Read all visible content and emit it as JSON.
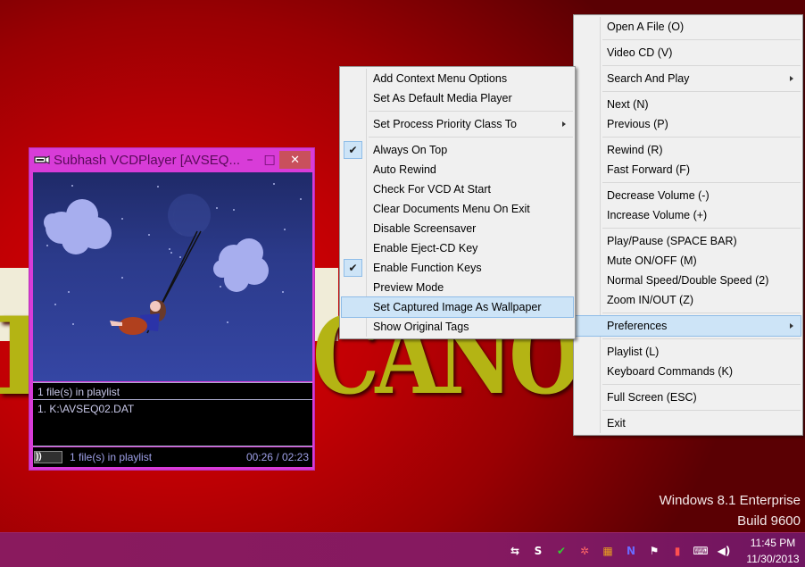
{
  "desktop": {
    "watermark_line1": "Windows 8.1 Enterprise",
    "watermark_line2": "Build 9600",
    "wallpaper_letters_left": "K",
    "wallpaper_letters_right": "CANO"
  },
  "player": {
    "title": "Subhash VCDPlayer [AVSEQ...",
    "icon": "vcd-app-icon",
    "minimize_label": "–",
    "maximize_label": "□",
    "close_label": "✕",
    "playlist_header": "1 file(s) in playlist",
    "playlist_items": [
      "1. K:\\AVSEQ02.DAT"
    ],
    "status_text": "1 file(s) in playlist",
    "time": "00:26 / 02:23",
    "seek_knob": "))",
    "seek_progress": 0.18
  },
  "main_menu": {
    "items": [
      {
        "label": "Open A File (O)"
      },
      {
        "sep": true
      },
      {
        "label": "Video CD (V)"
      },
      {
        "sep": true
      },
      {
        "label": "Search And Play",
        "submenu": true
      },
      {
        "sep": true
      },
      {
        "label": "Next (N)"
      },
      {
        "label": "Previous (P)"
      },
      {
        "sep": true
      },
      {
        "label": "Rewind (R)"
      },
      {
        "label": "Fast Forward (F)"
      },
      {
        "sep": true
      },
      {
        "label": "Decrease Volume (-)"
      },
      {
        "label": "Increase Volume (+)"
      },
      {
        "sep": true
      },
      {
        "label": "Play/Pause (SPACE BAR)"
      },
      {
        "label": "Mute ON/OFF (M)"
      },
      {
        "label": "Normal Speed/Double Speed (2)"
      },
      {
        "label": "Zoom IN/OUT (Z)"
      },
      {
        "sep": true
      },
      {
        "label": "Preferences",
        "submenu": true,
        "highlighted": true
      },
      {
        "sep": true
      },
      {
        "label": "Playlist (L)"
      },
      {
        "label": "Keyboard Commands (K)"
      },
      {
        "sep": true
      },
      {
        "label": "Full Screen  (ESC)"
      },
      {
        "sep": true
      },
      {
        "label": "Exit"
      }
    ]
  },
  "preferences_menu": {
    "items": [
      {
        "label": "Add Context Menu Options"
      },
      {
        "label": "Set As Default Media Player"
      },
      {
        "sep": true
      },
      {
        "label": "Set Process Priority Class To",
        "submenu": true
      },
      {
        "sep": true
      },
      {
        "label": "Always On Top",
        "checked": true
      },
      {
        "label": "Auto Rewind"
      },
      {
        "label": "Check For VCD At Start"
      },
      {
        "label": "Clear Documents Menu On Exit"
      },
      {
        "label": "Disable Screensaver"
      },
      {
        "label": "Enable Eject-CD Key"
      },
      {
        "label": "Enable Function Keys",
        "checked": true
      },
      {
        "label": "Preview Mode"
      },
      {
        "label": "Set Captured Image As Wallpaper",
        "highlighted": true
      },
      {
        "label": "Show Original Tags"
      }
    ]
  },
  "taskbar": {
    "tray_icons": [
      {
        "name": "vcdplayer-tray-icon",
        "glyph": "⇆",
        "color": "#ffffff"
      },
      {
        "name": "skype-tray-icon",
        "glyph": "S",
        "color": "#ffffff"
      },
      {
        "name": "usb-safe-remove-icon",
        "glyph": "✔",
        "color": "#33cc33"
      },
      {
        "name": "network-share-icon",
        "glyph": "✲",
        "color": "#ff6666"
      },
      {
        "name": "winrar-icon",
        "glyph": "▦",
        "color": "#e8a020"
      },
      {
        "name": "norton-icon",
        "glyph": "N",
        "color": "#6a6aff"
      },
      {
        "name": "action-center-flag-icon",
        "glyph": "⚑",
        "color": "#ffffff"
      },
      {
        "name": "power-battery-icon",
        "glyph": "▮",
        "color": "#ff5050"
      },
      {
        "name": "network-icon",
        "glyph": "⌨",
        "color": "#ffffff"
      },
      {
        "name": "volume-icon",
        "glyph": "◀)",
        "color": "#ffffff"
      }
    ],
    "clock_time": "11:45 PM",
    "clock_date": "11/30/2013"
  }
}
